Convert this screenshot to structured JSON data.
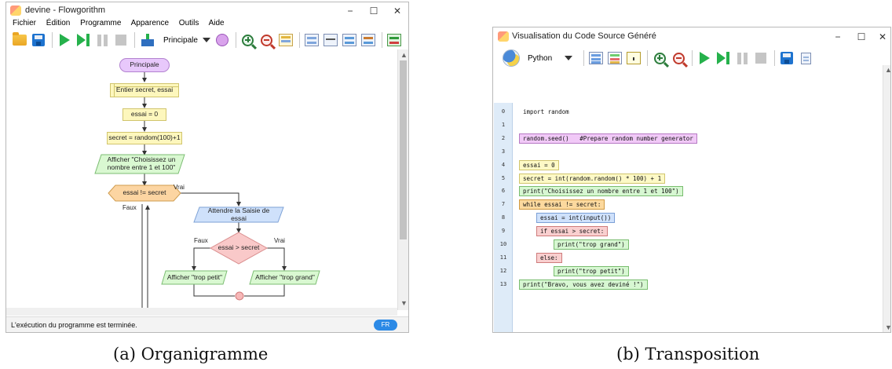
{
  "left_window": {
    "title": "devine - Flowgorithm",
    "menu": [
      "Fichier",
      "Édition",
      "Programme",
      "Apparence",
      "Outils",
      "Aide"
    ],
    "function_select": "Principale",
    "flowchart": {
      "start": "Principale",
      "declare": "Entier secret, essai",
      "assign1": "essai = 0",
      "assign2": "secret = random(100)+1",
      "output1": "Afficher \"Choisissez un nombre entre 1 et 100\"",
      "loop": "essai != secret",
      "loop_true": "Vrai",
      "loop_false": "Faux",
      "input": "Attendre la Saisie de essai",
      "if": "essai > secret",
      "if_false": "Faux",
      "if_true": "Vrai",
      "out_small": "Afficher \"trop petit\"",
      "out_big": "Afficher \"trop grand\""
    },
    "status": "L'exécution du programme est terminée.",
    "lang_badge": "FR"
  },
  "right_window": {
    "title": "Visualisation du Code Source Généré",
    "language": "Python",
    "lines": [
      {
        "n": "0",
        "text": "import random",
        "style": "plain",
        "indent": 0
      },
      {
        "n": "1",
        "text": "",
        "style": "none",
        "indent": 0
      },
      {
        "n": "2",
        "text": "random.seed()   #Prepare random number generator",
        "style": "pink",
        "indent": 0
      },
      {
        "n": "3",
        "text": "",
        "style": "none",
        "indent": 0
      },
      {
        "n": "4",
        "text": "essai = 0",
        "style": "yellow",
        "indent": 0
      },
      {
        "n": "5",
        "text": "secret = int(random.random() * 100) + 1",
        "style": "yellow",
        "indent": 0
      },
      {
        "n": "6",
        "text": "print(\"Choisissez un nombre entre 1 et 100\")",
        "style": "green",
        "indent": 0
      },
      {
        "n": "7",
        "text": "while essai != secret:",
        "style": "orange",
        "indent": 0
      },
      {
        "n": "8",
        "text": "essai = int(input())",
        "style": "blue",
        "indent": 1
      },
      {
        "n": "9",
        "text": "if essai > secret:",
        "style": "red",
        "indent": 1
      },
      {
        "n": "10",
        "text": "print(\"trop grand\")",
        "style": "green",
        "indent": 2
      },
      {
        "n": "11",
        "text": "else:",
        "style": "red",
        "indent": 1
      },
      {
        "n": "12",
        "text": "print(\"trop petit\")",
        "style": "green",
        "indent": 2
      },
      {
        "n": "13",
        "text": "print(\"Bravo, vous avez deviné !\")",
        "style": "green",
        "indent": 0
      }
    ]
  },
  "window_controls": {
    "minimize": "−",
    "maximize": "☐",
    "close": "✕"
  },
  "captions": {
    "left": "(a) Organigramme",
    "right": "(b) Transposition"
  }
}
